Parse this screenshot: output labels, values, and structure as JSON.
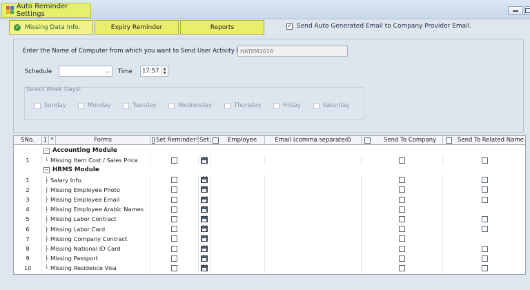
{
  "window": {
    "title": "Auto Reminder Settings",
    "accent_yellow": "#e9ef6c"
  },
  "tabs": [
    {
      "label": "Missing Data Info.",
      "active": true
    },
    {
      "label": "Expiry Reminder",
      "active": false
    },
    {
      "label": "Reports",
      "active": false
    }
  ],
  "send_email": {
    "label": "Send Auto Generated Email to Company Provider Email.",
    "checked": true
  },
  "settings": {
    "computer_label": "Enter the Name of Computer from which you want to  Send User Activity Report",
    "computer_value": "HATEM2016",
    "schedule_label": "Schedule",
    "schedule_value": "",
    "time_label": "Time",
    "time_value": "17:57",
    "week_days_title": "Select Week Days!",
    "days": [
      "Sunday",
      "Monday",
      "Tuesday",
      "Wednesday",
      "Thursday",
      "Friday",
      "Saturday"
    ]
  },
  "grid": {
    "headers": {
      "sno": "SNo.",
      "col1": "1",
      "star": "*",
      "forms": "Forms",
      "set_reminder": "Set Reminder!",
      "set_short": "Set",
      "employee": "Employee",
      "email": "Email (comma separated)",
      "send_company": "Send To Company",
      "send_related": "Send To Related Name"
    },
    "rows": [
      {
        "type": "group",
        "title": "Accounting Module"
      },
      {
        "type": "item",
        "sno": "1",
        "form": "Missing Item Cost / Sales Price",
        "related": true,
        "last": true
      },
      {
        "type": "group",
        "title": "HRMS Module"
      },
      {
        "type": "item",
        "sno": "1",
        "form": "Salary Info.",
        "related": true
      },
      {
        "type": "item",
        "sno": "2",
        "form": "Missing Employee Photo",
        "related": true
      },
      {
        "type": "item",
        "sno": "3",
        "form": "Missing Employee Email",
        "related": true
      },
      {
        "type": "item",
        "sno": "4",
        "form": "Missing Employee Arabic Names",
        "related": false
      },
      {
        "type": "item",
        "sno": "5",
        "form": "Missing Labor Contract",
        "related": true
      },
      {
        "type": "item",
        "sno": "6",
        "form": "Missing Labor Card",
        "related": true
      },
      {
        "type": "item",
        "sno": "7",
        "form": "Missing Company Contract",
        "related": false
      },
      {
        "type": "item",
        "sno": "8",
        "form": "Missing National ID Card",
        "related": true
      },
      {
        "type": "item",
        "sno": "9",
        "form": "Missing Passport",
        "related": true
      },
      {
        "type": "item",
        "sno": "10",
        "form": "Missing Residence Visa",
        "related": true,
        "last": true
      }
    ]
  }
}
